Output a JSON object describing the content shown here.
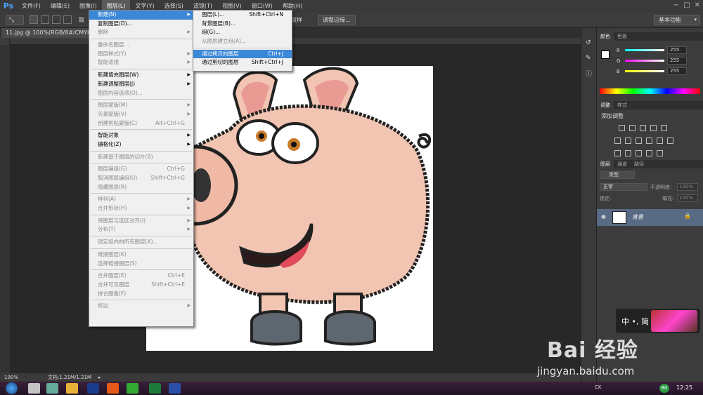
{
  "app": {
    "logo": "Ps"
  },
  "menubar": [
    "文件(F)",
    "编辑(E)",
    "图像(I)",
    "图层(L)",
    "文字(Y)",
    "选择(S)",
    "滤镜(T)",
    "视图(V)",
    "窗口(W)",
    "帮助(H)"
  ],
  "optionsbar": {
    "left_label": "取",
    "right_label": "取样",
    "refine_button": "调整边缘...",
    "workspace": "基本功能"
  },
  "document": {
    "tab_title": "11.jpg @ 100%(RGB/8#/CMYK) *",
    "zoom": "100%",
    "file_info": "文档:1.21M/1.21M"
  },
  "layer_menu": {
    "groups": [
      [
        {
          "label": "新建(N)",
          "arrow": true,
          "state": "active"
        },
        {
          "label": "复制图层(D)..."
        },
        {
          "label": "删除",
          "arrow": true,
          "disabled": true
        }
      ],
      [
        {
          "label": "重命名图层...",
          "disabled": true
        },
        {
          "label": "图层样式(Y)",
          "arrow": true,
          "disabled": true
        },
        {
          "label": "智能滤镜",
          "arrow": true,
          "disabled": true
        }
      ],
      [
        {
          "label": "新建填充图层(W)",
          "arrow": true
        },
        {
          "label": "新建调整图层(J)",
          "arrow": true
        },
        {
          "label": "图层内容选项(O)...",
          "disabled": true
        }
      ],
      [
        {
          "label": "图层蒙版(M)",
          "arrow": true,
          "disabled": true
        },
        {
          "label": "矢量蒙版(V)",
          "arrow": true,
          "disabled": true
        },
        {
          "label": "创建剪贴蒙版(C)",
          "shortcut": "Alt+Ctrl+G",
          "disabled": true
        }
      ],
      [
        {
          "label": "智能对象",
          "arrow": true
        },
        {
          "label": "栅格化(Z)",
          "arrow": true
        }
      ],
      [
        {
          "label": "新建基于图层的切片(B)",
          "disabled": true
        }
      ],
      [
        {
          "label": "图层编组(G)",
          "shortcut": "Ctrl+G",
          "disabled": true
        },
        {
          "label": "取消图层编组(U)",
          "shortcut": "Shift+Ctrl+G",
          "disabled": true
        },
        {
          "label": "隐藏图层(R)",
          "disabled": true
        }
      ],
      [
        {
          "label": "排列(A)",
          "arrow": true,
          "disabled": true
        },
        {
          "label": "合并形状(H)",
          "arrow": true,
          "disabled": true
        }
      ],
      [
        {
          "label": "将图层与选区对齐(I)",
          "arrow": true,
          "disabled": true
        },
        {
          "label": "分布(T)",
          "arrow": true,
          "disabled": true
        }
      ],
      [
        {
          "label": "锁定组内的所有图层(X)...",
          "disabled": true
        }
      ],
      [
        {
          "label": "链接图层(K)",
          "disabled": true
        },
        {
          "label": "选择链接图层(S)",
          "disabled": true
        }
      ],
      [
        {
          "label": "合并图层(E)",
          "shortcut": "Ctrl+E",
          "disabled": true
        },
        {
          "label": "合并可见图层",
          "shortcut": "Shift+Ctrl+E",
          "disabled": true
        },
        {
          "label": "拼合图像(F)",
          "disabled": true
        }
      ],
      [
        {
          "label": "修边",
          "arrow": true,
          "disabled": true
        }
      ]
    ]
  },
  "new_submenu": {
    "groups": [
      [
        {
          "label": "图层(L)...",
          "shortcut": "Shift+Ctrl+N"
        },
        {
          "label": "背景图层(B)..."
        },
        {
          "label": "组(G)..."
        },
        {
          "label": "从图层建立组(A)...",
          "disabled": true
        }
      ],
      [
        {
          "label": "通过拷贝的图层",
          "shortcut": "Ctrl+J",
          "state": "highlighted"
        },
        {
          "label": "通过剪切的图层",
          "shortcut": "Shift+Ctrl+J"
        }
      ]
    ]
  },
  "color_panel": {
    "tabs": [
      "颜色",
      "色板"
    ],
    "channels": [
      {
        "name": "R",
        "value": "255"
      },
      {
        "name": "G",
        "value": "255"
      },
      {
        "name": "B",
        "value": "255"
      }
    ]
  },
  "adjust_panel": {
    "tabs": [
      "调整",
      "样式"
    ],
    "title": "添加调整"
  },
  "layers_panel": {
    "tabs": [
      "图层",
      "通道",
      "路径"
    ],
    "filter": "类型",
    "blend_mode": "正常",
    "opacity_label": "不透明度:",
    "opacity_value": "100%",
    "lock_label": "锁定:",
    "fill_label": "填充:",
    "fill_value": "100%",
    "layers": [
      {
        "name": "背景"
      }
    ]
  },
  "ime": {
    "text": "中 •, 简"
  },
  "watermark": {
    "brand": "Bai 经验",
    "url": "jingyan.baidu.com"
  },
  "taskbar": {
    "time": "12:25",
    "tray_badge": "80",
    "lang": "CK"
  },
  "colors": {
    "menu_highlight": "#3b87d8",
    "pig_body": "#f2c4b2",
    "pig_hoof": "#5e6670"
  }
}
